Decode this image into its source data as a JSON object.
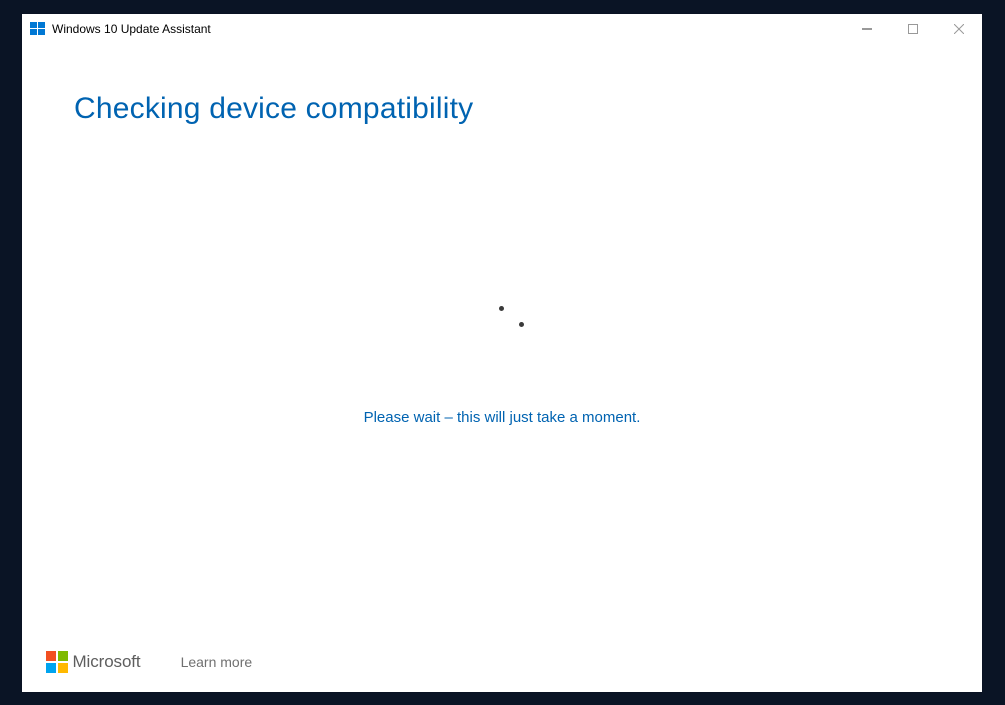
{
  "titlebar": {
    "title": "Windows 10 Update Assistant"
  },
  "content": {
    "heading": "Checking device compatibility",
    "status_text": "Please wait – this will just take a moment."
  },
  "footer": {
    "logo_text": "Microsoft",
    "learn_more": "Learn more"
  },
  "colors": {
    "accent": "#0063b1",
    "ms_red": "#f25022",
    "ms_green": "#7fba00",
    "ms_blue": "#00a4ef",
    "ms_yellow": "#ffb900"
  }
}
